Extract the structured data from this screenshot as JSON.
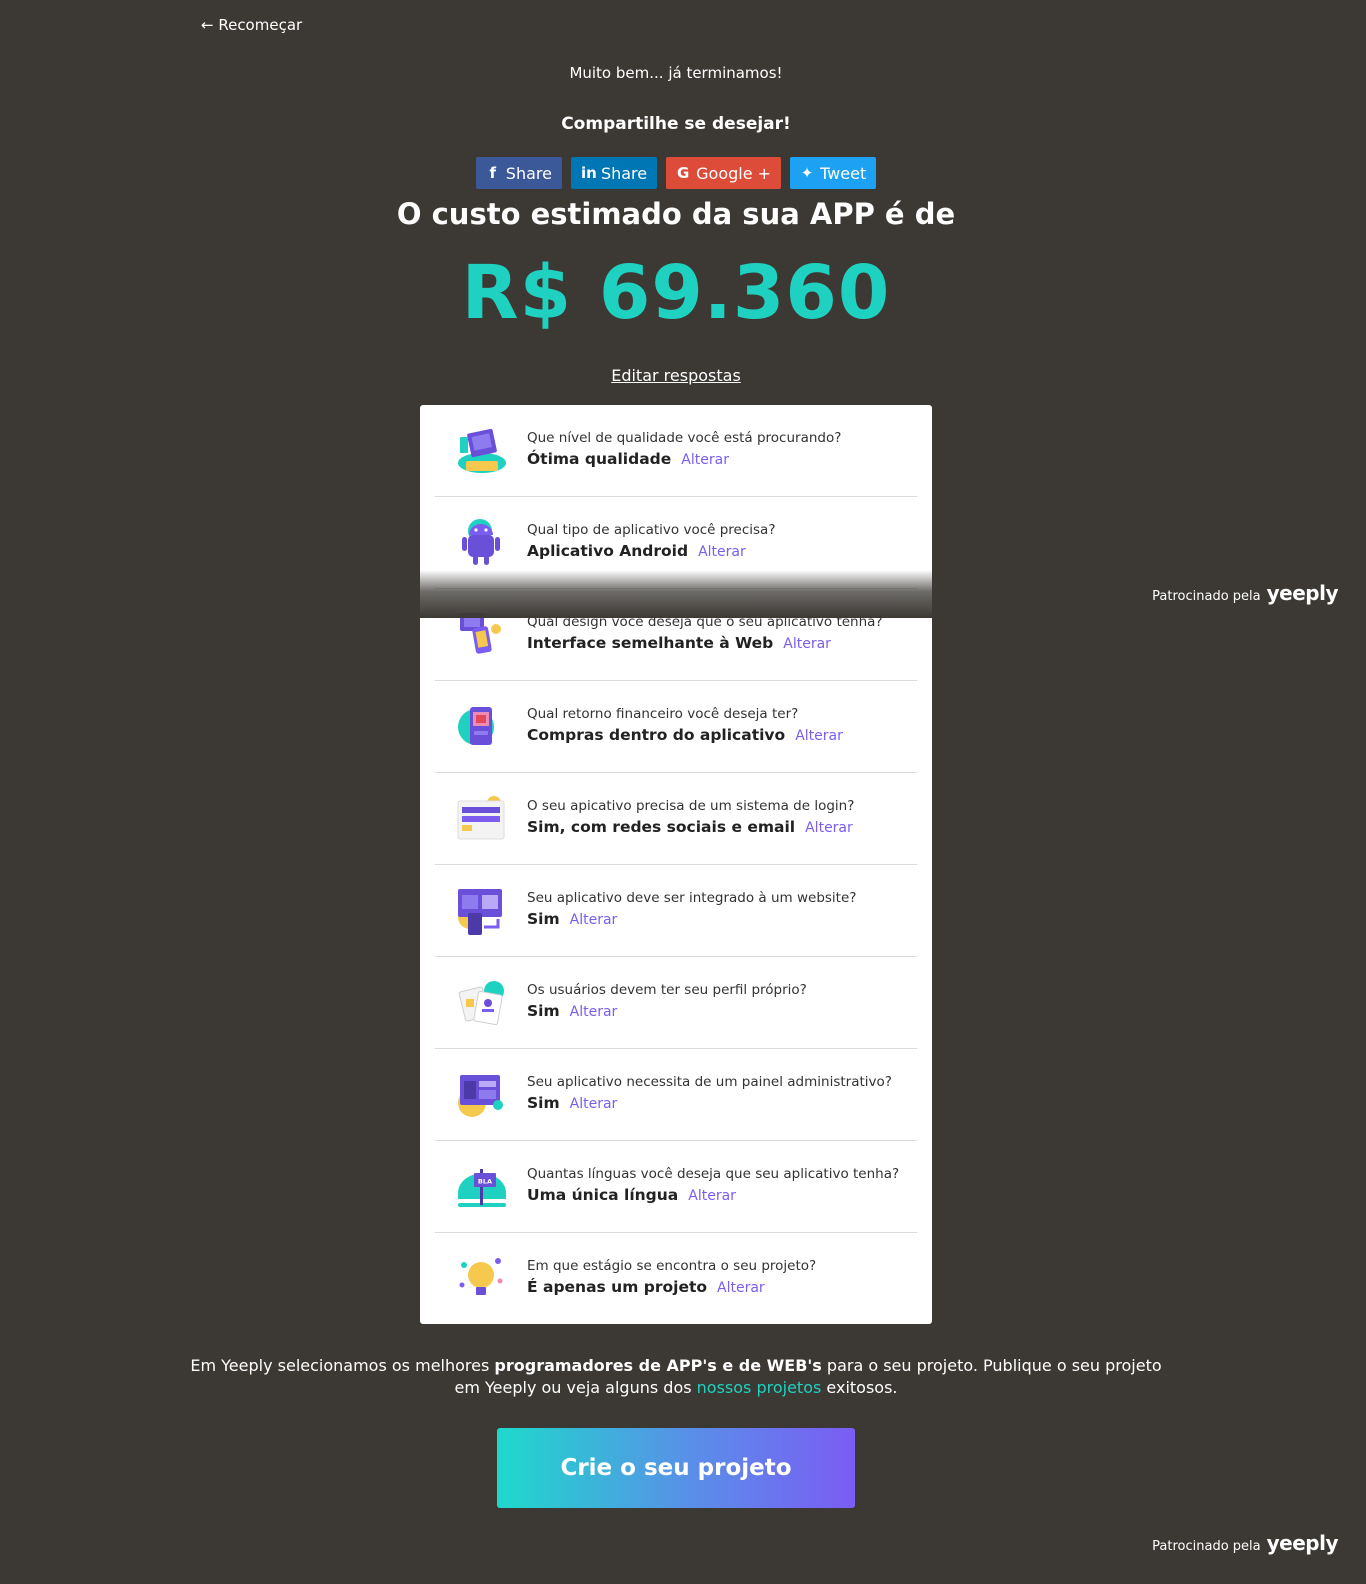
{
  "nav": {
    "restart_label": "← Recomeçar"
  },
  "hero": {
    "done_text": "Muito bem... já terminamos!",
    "share_title": "Compartilhe se desejar!",
    "share_buttons": [
      {
        "icon": "facebook-icon",
        "glyph": "f",
        "label": "Share",
        "color": "#3b5998"
      },
      {
        "icon": "linkedin-icon",
        "glyph": "in",
        "label": "Share",
        "color": "#0077b5"
      },
      {
        "icon": "google-icon",
        "glyph": "G",
        "label": "Google +",
        "color": "#dd4b39"
      },
      {
        "icon": "twitter-icon",
        "glyph": "✦",
        "label": "Tweet",
        "color": "#1da1f2"
      }
    ],
    "headline": "O custo estimado da sua APP é de",
    "price": "R$ 69.360",
    "edit_label": "Editar respostas"
  },
  "sponsor": {
    "prefix": "Patrocinado pela",
    "brand": "yeeply"
  },
  "answers": [
    {
      "icon": "quality-icon",
      "question": "Que nível de qualidade você está procurando?",
      "answer": "Ótima qualidade",
      "alter": "Alterar"
    },
    {
      "icon": "android-icon",
      "question": "Qual tipo de aplicativo você precisa?",
      "answer": "Aplicativo Android",
      "alter": "Alterar"
    },
    {
      "icon": "design-icon",
      "question": "Qual design você deseja que o seu aplicativo tenha?",
      "answer": "Interface semelhante à Web",
      "alter": "Alterar"
    },
    {
      "icon": "purchase-icon",
      "question": "Qual retorno financeiro você deseja ter?",
      "answer": "Compras dentro do aplicativo",
      "alter": "Alterar"
    },
    {
      "icon": "login-icon",
      "question": "O seu apicativo precisa de um sistema de login?",
      "answer": "Sim, com redes sociais e email",
      "alter": "Alterar"
    },
    {
      "icon": "website-icon",
      "question": "Seu aplicativo deve ser integrado à um website?",
      "answer": "Sim",
      "alter": "Alterar"
    },
    {
      "icon": "profile-icon",
      "question": "Os usuários devem ter seu perfil próprio?",
      "answer": "Sim",
      "alter": "Alterar"
    },
    {
      "icon": "admin-panel-icon",
      "question": "Seu aplicativo necessita de um painel administrativo?",
      "answer": "Sim",
      "alter": "Alterar"
    },
    {
      "icon": "language-icon",
      "question": "Quantas línguas você deseja que seu aplicativo tenha?",
      "answer": "Uma única língua",
      "alter": "Alterar"
    },
    {
      "icon": "idea-icon",
      "question": "Em que estágio se encontra o seu projeto?",
      "answer": "É apenas um projeto",
      "alter": "Alterar"
    }
  ],
  "footer": {
    "text_1": "Em Yeeply selecionamos os melhores ",
    "text_bold": "programadores de APP's e de WEB's",
    "text_2": " para o seu projeto. Publique o seu projeto",
    "text_3": "em Yeeply ou veja alguns dos ",
    "link": "nossos projetos",
    "text_4": " exitosos.",
    "cta_label": "Crie o seu projeto"
  },
  "colors": {
    "background": "#3c3935",
    "accent_green": "#1fd1c0",
    "accent_purple": "#7b5df0"
  }
}
